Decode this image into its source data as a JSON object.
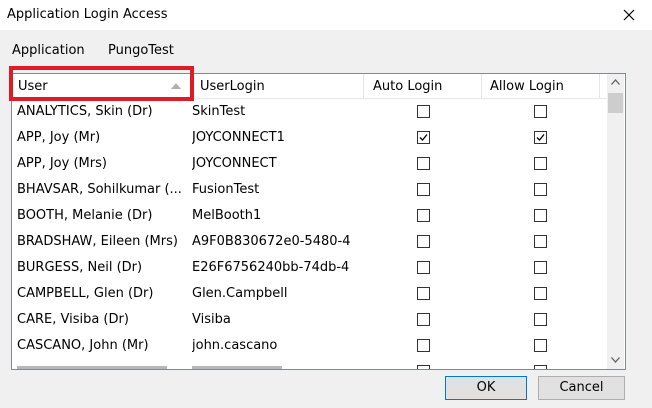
{
  "window": {
    "title": "Application Login Access"
  },
  "application": {
    "label": "Application",
    "value": "PungoTest"
  },
  "grid": {
    "columns": [
      "User",
      "UserLogin",
      "Auto Login",
      "Allow Login"
    ],
    "rows": [
      {
        "user": "ANALYTICS, Skin (Dr)",
        "login": "SkinTest",
        "auto": false,
        "allow": false
      },
      {
        "user": "APP, Joy (Mr)",
        "login": "JOYCONNECT1",
        "auto": true,
        "allow": true
      },
      {
        "user": "APP, Joy (Mrs)",
        "login": "JOYCONNECT",
        "auto": false,
        "allow": false
      },
      {
        "user": "BHAVSAR, Sohilkumar (...",
        "login": "FusionTest",
        "auto": false,
        "allow": false
      },
      {
        "user": "BOOTH, Melanie (Dr)",
        "login": "MelBooth1",
        "auto": false,
        "allow": false
      },
      {
        "user": "BRADSHAW, Eileen (Mrs)",
        "login": "A9F0B830672e0-5480-4",
        "auto": false,
        "allow": false
      },
      {
        "user": "BURGESS, Neil (Dr)",
        "login": "E26F6756240bb-74db-4",
        "auto": false,
        "allow": false
      },
      {
        "user": "CAMPBELL, Glen (Dr)",
        "login": "Glen.Campbell",
        "auto": false,
        "allow": false
      },
      {
        "user": "CARE, Visiba (Dr)",
        "login": "Visiba",
        "auto": false,
        "allow": false
      },
      {
        "user": "CASCANO, John (Mr)",
        "login": "john.cascano",
        "auto": false,
        "allow": false
      }
    ]
  },
  "buttons": {
    "ok": "OK",
    "cancel": "Cancel"
  },
  "colors": {
    "highlight": "#e01b24",
    "ok_border": "#0078d7"
  }
}
